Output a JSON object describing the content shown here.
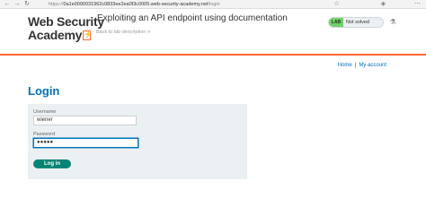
{
  "browser": {
    "back_icon": "←",
    "forward_icon": "→",
    "reload_icon": "↻",
    "url_prefix": "https://",
    "url_host": "0a1e0090031962c0833ee2ea0f3c0005.web-security-academy.net",
    "url_path": "/login",
    "star_icon": "☆",
    "shield_icon": "◈",
    "extensions_icon": "⋯"
  },
  "header": {
    "logo_line1": "Web Security",
    "logo_line2": "Academy",
    "logo_glyph": "⚡",
    "lab_title": "Exploiting an API endpoint using documentation",
    "back_label": "Back to lab description",
    "back_icon": "»",
    "status_tag": "LAB",
    "status_text": "Not solved",
    "flask_icon": "⚗",
    "accent_color": "#ff6633"
  },
  "nav": {
    "home": "Home",
    "separator": "|",
    "my_account": "My account"
  },
  "login": {
    "heading": "Login",
    "username_label": "Username",
    "username_value": "wiener",
    "password_label": "Password",
    "password_value": "●●●●●",
    "submit_label": "Log in",
    "button_color": "#008474"
  }
}
